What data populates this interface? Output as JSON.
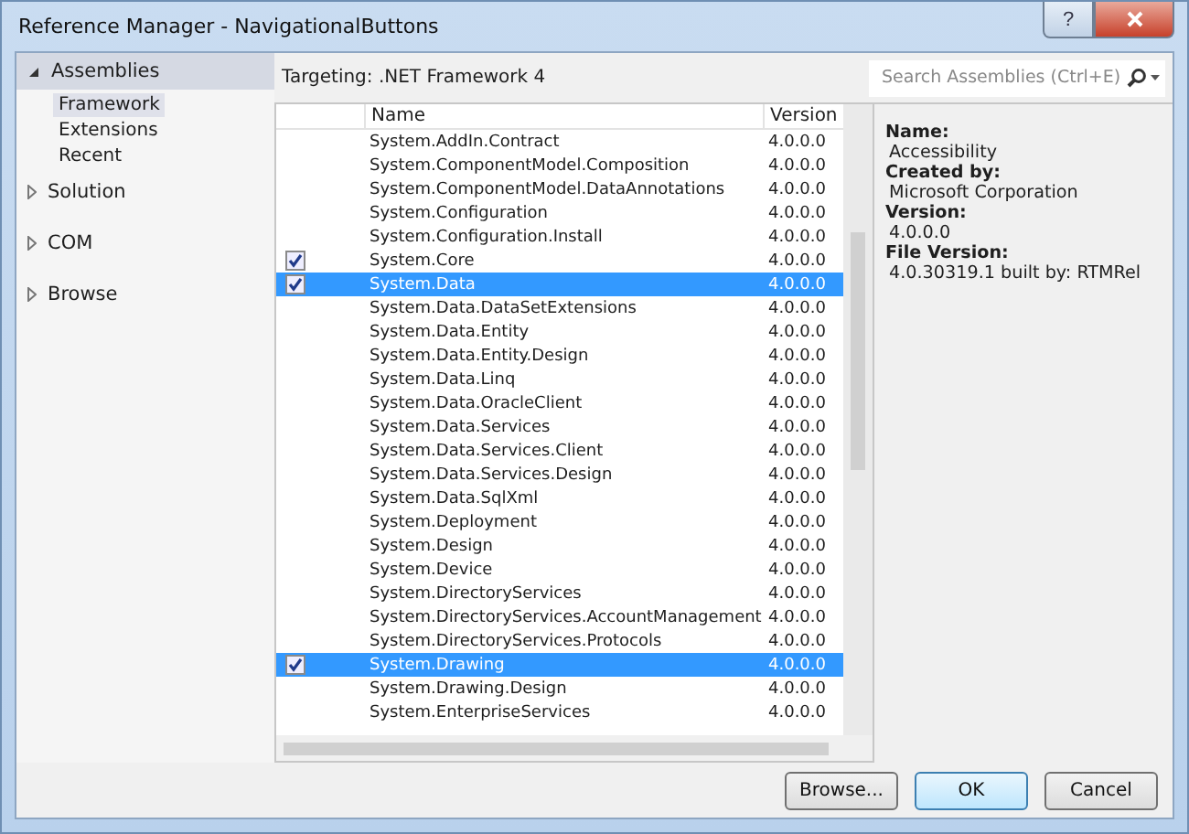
{
  "window": {
    "title": "Reference Manager - NavigationalButtons",
    "help_button": "?"
  },
  "sidebar": {
    "items": [
      {
        "label": "Assemblies",
        "expanded": true,
        "children": [
          {
            "label": "Framework",
            "selected": true
          },
          {
            "label": "Extensions",
            "selected": false
          },
          {
            "label": "Recent",
            "selected": false
          }
        ]
      },
      {
        "label": "Solution",
        "expanded": false
      },
      {
        "label": "COM",
        "expanded": false
      },
      {
        "label": "Browse",
        "expanded": false
      }
    ]
  },
  "targeting": "Targeting: .NET Framework 4",
  "search": {
    "placeholder": "Search Assemblies (Ctrl+E)"
  },
  "table": {
    "columns": [
      "Name",
      "Version"
    ],
    "rows": [
      {
        "name": "System.AddIn.Contract",
        "version": "4.0.0.0",
        "checked": false,
        "selected": false
      },
      {
        "name": "System.ComponentModel.Composition",
        "version": "4.0.0.0",
        "checked": false,
        "selected": false
      },
      {
        "name": "System.ComponentModel.DataAnnotations",
        "version": "4.0.0.0",
        "checked": false,
        "selected": false
      },
      {
        "name": "System.Configuration",
        "version": "4.0.0.0",
        "checked": false,
        "selected": false
      },
      {
        "name": "System.Configuration.Install",
        "version": "4.0.0.0",
        "checked": false,
        "selected": false
      },
      {
        "name": "System.Core",
        "version": "4.0.0.0",
        "checked": true,
        "selected": false
      },
      {
        "name": "System.Data",
        "version": "4.0.0.0",
        "checked": true,
        "selected": true
      },
      {
        "name": "System.Data.DataSetExtensions",
        "version": "4.0.0.0",
        "checked": false,
        "selected": false
      },
      {
        "name": "System.Data.Entity",
        "version": "4.0.0.0",
        "checked": false,
        "selected": false
      },
      {
        "name": "System.Data.Entity.Design",
        "version": "4.0.0.0",
        "checked": false,
        "selected": false
      },
      {
        "name": "System.Data.Linq",
        "version": "4.0.0.0",
        "checked": false,
        "selected": false
      },
      {
        "name": "System.Data.OracleClient",
        "version": "4.0.0.0",
        "checked": false,
        "selected": false
      },
      {
        "name": "System.Data.Services",
        "version": "4.0.0.0",
        "checked": false,
        "selected": false
      },
      {
        "name": "System.Data.Services.Client",
        "version": "4.0.0.0",
        "checked": false,
        "selected": false
      },
      {
        "name": "System.Data.Services.Design",
        "version": "4.0.0.0",
        "checked": false,
        "selected": false
      },
      {
        "name": "System.Data.SqlXml",
        "version": "4.0.0.0",
        "checked": false,
        "selected": false
      },
      {
        "name": "System.Deployment",
        "version": "4.0.0.0",
        "checked": false,
        "selected": false
      },
      {
        "name": "System.Design",
        "version": "4.0.0.0",
        "checked": false,
        "selected": false
      },
      {
        "name": "System.Device",
        "version": "4.0.0.0",
        "checked": false,
        "selected": false
      },
      {
        "name": "System.DirectoryServices",
        "version": "4.0.0.0",
        "checked": false,
        "selected": false
      },
      {
        "name": "System.DirectoryServices.AccountManagement",
        "version": "4.0.0.0",
        "checked": false,
        "selected": false
      },
      {
        "name": "System.DirectoryServices.Protocols",
        "version": "4.0.0.0",
        "checked": false,
        "selected": false
      },
      {
        "name": "System.Drawing",
        "version": "4.0.0.0",
        "checked": true,
        "selected": true
      },
      {
        "name": "System.Drawing.Design",
        "version": "4.0.0.0",
        "checked": false,
        "selected": false
      },
      {
        "name": "System.EnterpriseServices",
        "version": "4.0.0.0",
        "checked": false,
        "selected": false
      }
    ]
  },
  "details": [
    {
      "label": "Name:",
      "value": "Accessibility"
    },
    {
      "label": "Created by:",
      "value": "Microsoft Corporation"
    },
    {
      "label": "Version:",
      "value": "4.0.0.0"
    },
    {
      "label": "File Version:",
      "value": "4.0.30319.1 built by: RTMRel"
    }
  ],
  "buttons": [
    {
      "label": "Browse...",
      "default": false
    },
    {
      "label": "OK",
      "default": true
    },
    {
      "label": "Cancel",
      "default": false
    }
  ]
}
